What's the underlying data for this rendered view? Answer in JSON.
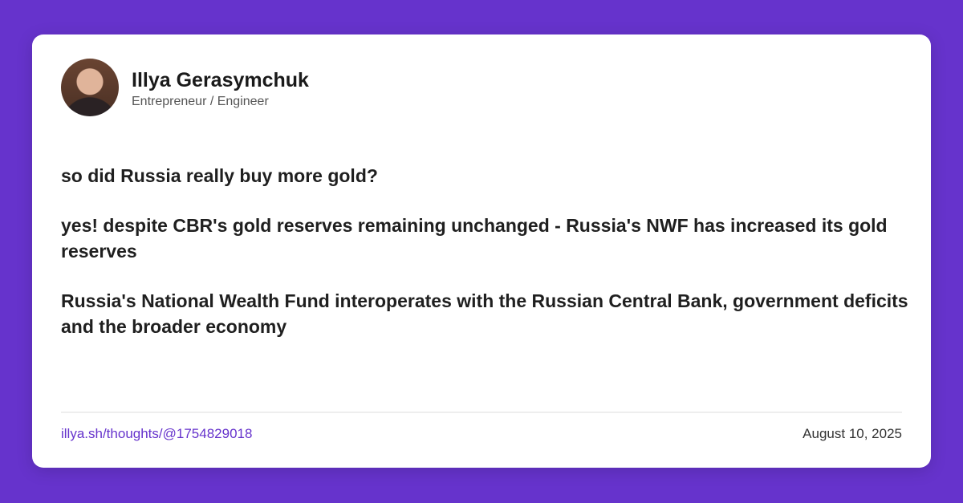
{
  "author": {
    "name": "Illya Gerasymchuk",
    "role": "Entrepreneur / Engineer"
  },
  "post": {
    "paragraphs": [
      "so did Russia really buy more gold?",
      "yes! despite CBR's gold reserves remaining unchanged - Russia's NWF has increased its gold reserves",
      "Russia's National Wealth Fund interoperates with the Russian Central Bank, government deficits and the broader economy"
    ]
  },
  "footer": {
    "link": "illya.sh/thoughts/@1754829018",
    "date": "August 10, 2025"
  },
  "colors": {
    "accent": "#6633cc"
  }
}
